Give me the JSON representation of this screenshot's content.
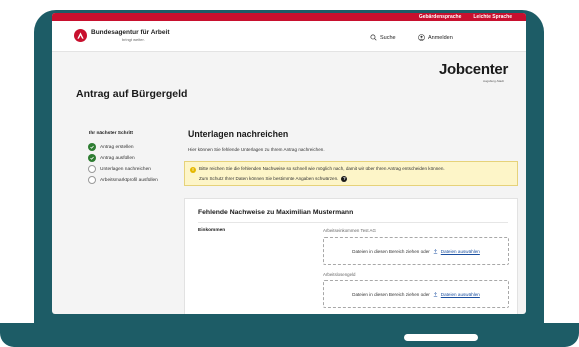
{
  "utility_bar": {
    "sign_language": "Gebärdensprache",
    "easy_language": "Leichte Sprache"
  },
  "header": {
    "org_name": "Bundesagentur für Arbeit",
    "org_tagline": "bringt weiter.",
    "search_label": "Suche",
    "login_label": "Anmelden"
  },
  "brand": {
    "logo_text": "Jobcenter",
    "logo_sub": "Augsburg-Stadt"
  },
  "page_title": "Antrag auf Bürgergeld",
  "steps": {
    "title": "Ihr nächster Schritt",
    "items": [
      {
        "label": "Antrag erstellen",
        "status": "done"
      },
      {
        "label": "Antrag ausfüllen",
        "status": "done"
      },
      {
        "label": "Unterlagen nachreichen",
        "status": "open"
      },
      {
        "label": "Arbeitsmarktprofil ausfüllen",
        "status": "open"
      }
    ]
  },
  "main": {
    "title": "Unterlagen nachreichen",
    "description": "Hier können Sie fehlende Unterlagen zu Ihrem Antrag nachreichen.",
    "alert_line1": "Bitte reichen Sie die fehlenden Nachweise so schnell wie möglich nach, damit wir über Ihren Antrag entscheiden können.",
    "alert_line2": "Zum Schutz Ihrer Daten können Sie bestimmte Angaben schwärzen."
  },
  "card": {
    "title": "Fehlende Nachweise zu Maximilian Mustermann",
    "category": "Einkommen",
    "uploads": [
      {
        "label": "Arbeitseinkommen Test AG",
        "drop_text": "Dateien in diesen Bereich ziehen oder",
        "select_link": "Dateien auswählen"
      },
      {
        "label": "Arbeitslosengeld",
        "drop_text": "Dateien in diesen Bereich ziehen oder",
        "select_link": "Dateien auswählen"
      }
    ]
  },
  "colors": {
    "frame": "#1d5c66",
    "accent_red": "#c8102e",
    "done_green": "#2e7d32",
    "alert_bg": "#fdf5c8",
    "link_blue": "#1a4fa0"
  }
}
